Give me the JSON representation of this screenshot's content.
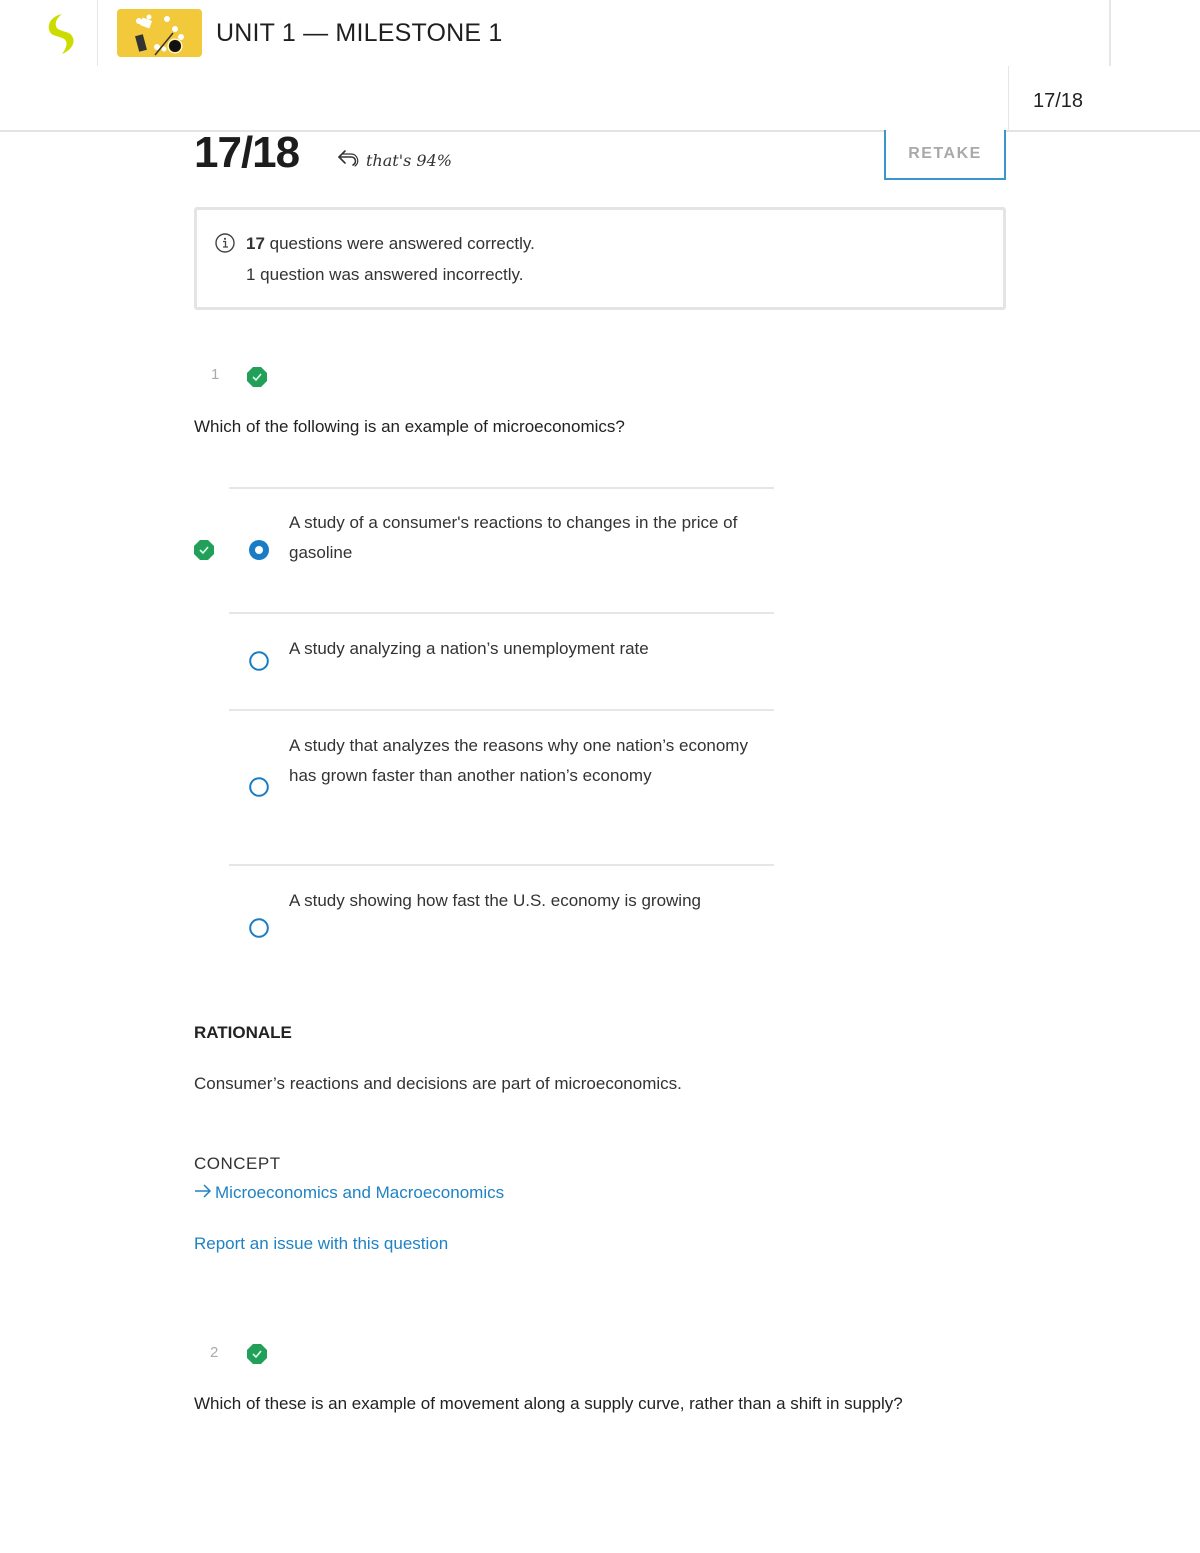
{
  "header": {
    "logo_icon": "sophia-logo-icon",
    "course_thumbnail": "course-thumbnail-image",
    "title": "UNIT 1 — MILESTONE 1",
    "score_tab": "17/18"
  },
  "score": {
    "value": "17/18",
    "percent_note": "that's 94%",
    "percent_icon": "curved-arrow-back-icon",
    "retake_label": "RETAKE"
  },
  "summary": {
    "icon": "info-icon",
    "correct_count": "17",
    "correct_text": " questions were answered correctly.",
    "incorrect_text": "1 question was answered incorrectly."
  },
  "questions": [
    {
      "number": "1",
      "status": "correct",
      "text": "Which of the following is an example of microeconomics?",
      "options": [
        {
          "text": "A study of a consumer's reactions to changes in the price of gasoline",
          "selected": true,
          "correct": true
        },
        {
          "text": "A study analyzing a nation’s unemployment rate",
          "selected": false,
          "correct": false
        },
        {
          "text": "A study that analyzes the reasons why one nation’s economy has grown faster than another nation’s economy",
          "selected": false,
          "correct": false
        },
        {
          "text": "A study showing how fast the U.S. economy is growing",
          "selected": false,
          "correct": false
        }
      ],
      "rationale_heading": "RATIONALE",
      "rationale_text": "Consumer’s reactions and decisions are part of microeconomics.",
      "concept_heading": "CONCEPT",
      "concept_link": "Microeconomics and Macroeconomics",
      "report_link": "Report an issue with this question"
    },
    {
      "number": "2",
      "status": "correct",
      "text": "Which of these is an example of movement along a supply curve, rather than a shift in supply?"
    }
  ],
  "colors": {
    "correct_green": "#22a05a",
    "accent_blue": "#1f82c4",
    "radio_blue": "#1a7cc4",
    "logo_lime": "#cddc00"
  }
}
